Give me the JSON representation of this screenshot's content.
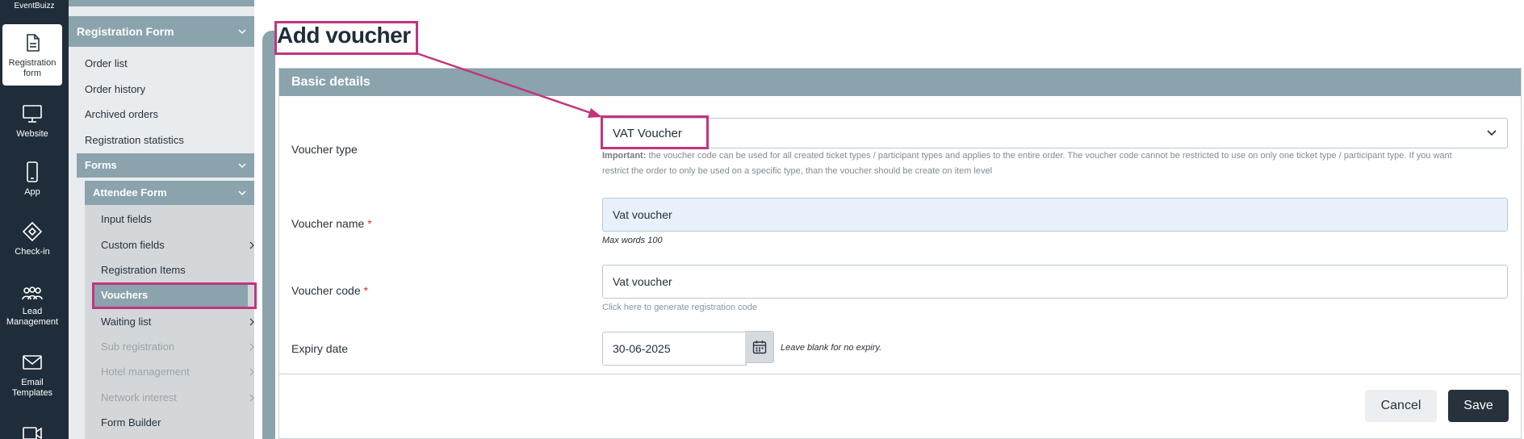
{
  "app": {
    "logo_text": "EventBuizz"
  },
  "rail": {
    "items": [
      {
        "label": "Registration form",
        "icon": "document-icon"
      },
      {
        "label": "Website",
        "icon": "monitor-icon"
      },
      {
        "label": "App",
        "icon": "mobile-icon"
      },
      {
        "label": "Check-in",
        "icon": "ticket-icon"
      },
      {
        "label": "Lead Management",
        "icon": "people-icon"
      },
      {
        "label": "Email Templates",
        "icon": "mail-icon"
      }
    ]
  },
  "menu": {
    "registration_form": "Registration Form",
    "order_list": "Order list",
    "order_history": "Order history",
    "archived_orders": "Archived orders",
    "registration_statistics": "Registration statistics",
    "forms": "Forms",
    "attendee_form": "Attendee Form",
    "input_fields": "Input fields",
    "custom_fields": "Custom fields",
    "registration_items": "Registration Items",
    "vouchers": "Vouchers",
    "waiting_list": "Waiting list",
    "sub_registration": "Sub registration",
    "hotel_management": "Hotel management",
    "network_interest": "Network interest",
    "form_builder": "Form Builder"
  },
  "page": {
    "title": "Add voucher",
    "section_title": "Basic details"
  },
  "form": {
    "voucher_type": {
      "label": "Voucher type",
      "value": "VAT Voucher",
      "note_strong": "Important:",
      "note_line1": " the voucher code can be used for all created ticket types / participant types and applies to the entire order. The voucher code cannot be restricted to use on only one ticket type / participant type. If you want",
      "note_line2": "restrict the order to only be used on a specific type, than the voucher should be create on item level"
    },
    "voucher_name": {
      "label": "Voucher name",
      "required_mark": "*",
      "value": "Vat voucher",
      "hint": "Max words 100"
    },
    "voucher_code": {
      "label": "Voucher code",
      "required_mark": "*",
      "value": "Vat voucher",
      "hint": "Click here to generate registration code"
    },
    "expiry_date": {
      "label": "Expiry date",
      "value": "30-06-2025",
      "hint": "Leave blank for no expiry."
    }
  },
  "actions": {
    "cancel": "Cancel",
    "save": "Save"
  },
  "colors": {
    "rail_bg": "#1f2d3a",
    "menu_header": "#8aa3ad",
    "highlight": "#c2347f",
    "save_bg": "#27323c"
  }
}
